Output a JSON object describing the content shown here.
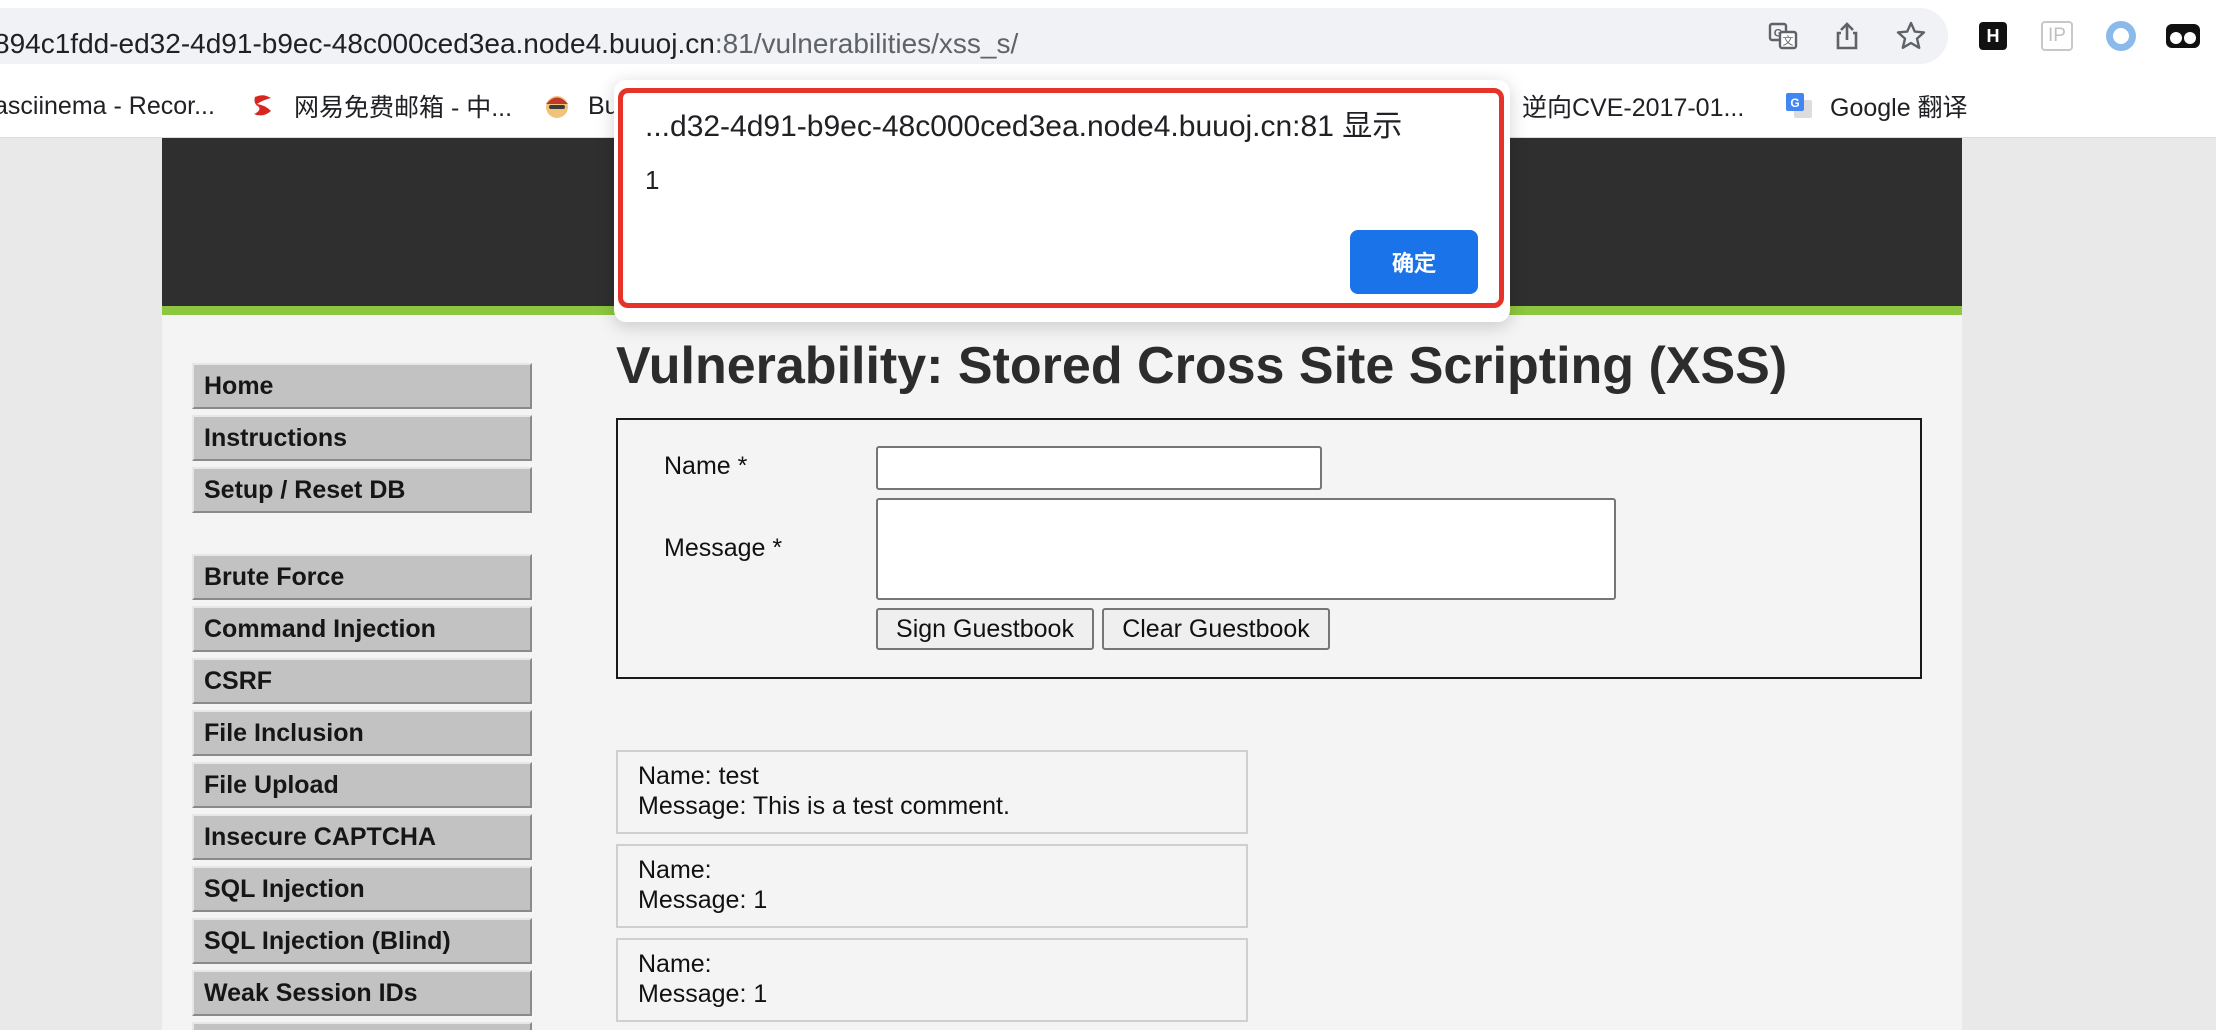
{
  "browser": {
    "url_host": "894c1fdd-ed32-4d91-b9ec-48c000ced3ea.node4.buuoj.cn",
    "url_rest": ":81/vulnerabilities/xss_s/",
    "toolbar_icons": [
      "translate-icon",
      "share-icon",
      "bookmark-star-icon"
    ],
    "extensions": [
      "extension-h-icon",
      "extension-ip-icon",
      "extension-circle-icon",
      "extension-glasses-icon"
    ],
    "extension_ip_label": "IP",
    "extension_h_label": "H",
    "bookmarks": [
      {
        "label": "asciinema - Recor...",
        "icon": "none"
      },
      {
        "label": "网易免费邮箱 - 中...",
        "icon": "netease-mail-icon"
      },
      {
        "label": "Bu",
        "icon": "avatar-icon"
      },
      {
        "label": "逆向CVE-2017-01...",
        "icon": "half-circle-icon"
      },
      {
        "label": "Google 翻译",
        "icon": "google-translate-icon"
      }
    ]
  },
  "dvwa": {
    "title": "Vulnerability: Stored Cross Site Scripting (XSS)",
    "menu_top": [
      "Home",
      "Instructions",
      "Setup / Reset DB"
    ],
    "menu_vulns": [
      "Brute Force",
      "Command Injection",
      "CSRF",
      "File Inclusion",
      "File Upload",
      "Insecure CAPTCHA",
      "SQL Injection",
      "SQL Injection (Blind)",
      "Weak Session IDs"
    ],
    "form": {
      "name_label": "Name *",
      "message_label": "Message *",
      "name_value": "",
      "message_value": "",
      "sign_button": "Sign Guestbook",
      "clear_button": "Clear Guestbook"
    },
    "entries": [
      {
        "name": "Name: test",
        "message": "Message: This is a test comment."
      },
      {
        "name": "Name:",
        "message": "Message: 1"
      },
      {
        "name": "Name:",
        "message": "Message: 1"
      }
    ]
  },
  "alert": {
    "title": "...d32-4d91-b9ec-48c000ced3ea.node4.buuoj.cn:81 显示",
    "message": "1",
    "ok_button": "确定",
    "highlight_color": "#e53329",
    "button_color": "#1a73e8"
  }
}
